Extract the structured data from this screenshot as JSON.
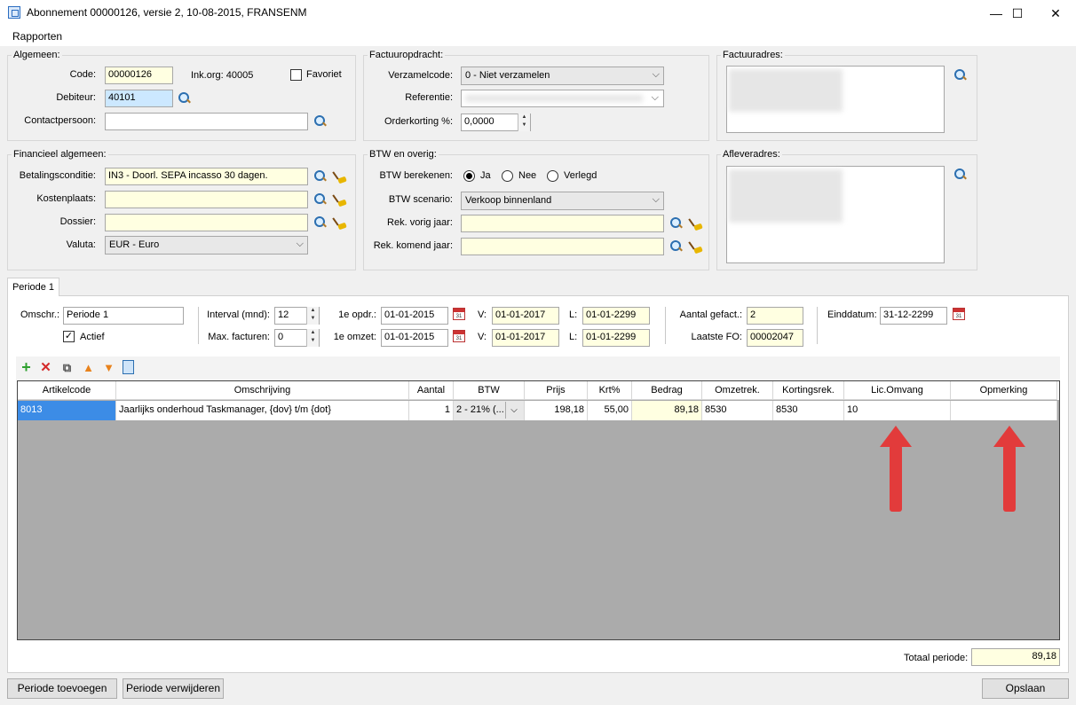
{
  "window": {
    "title": "Abonnement 00000126, versie 2, 10-08-2015, FRANSENM",
    "minimize": "—",
    "maximize": "☐",
    "close": "✕"
  },
  "menu": {
    "rapporten": "Rapporten"
  },
  "algemeen": {
    "legend": "Algemeen:",
    "code_label": "Code:",
    "code_value": "00000126",
    "inkorg": "Ink.org: 40005",
    "favoriet": "Favoriet",
    "debiteur_label": "Debiteur:",
    "debiteur_value": "40101",
    "contact_label": "Contactpersoon:",
    "contact_value": ""
  },
  "factuuropdracht": {
    "legend": "Factuuropdracht:",
    "verzamel_label": "Verzamelcode:",
    "verzamel_value": "0 - Niet verzamelen",
    "referentie_label": "Referentie:",
    "orderkorting_label": "Orderkorting %:",
    "orderkorting_value": "0,0000"
  },
  "factuuradres": {
    "legend": "Factuuradres:"
  },
  "financieel": {
    "legend": "Financieel algemeen:",
    "betaling_label": "Betalingsconditie:",
    "betaling_value": "IN3 - Doorl. SEPA incasso 30 dagen.",
    "kosten_label": "Kostenplaats:",
    "kosten_value": "",
    "dossier_label": "Dossier:",
    "dossier_value": "",
    "valuta_label": "Valuta:",
    "valuta_value": "EUR - Euro"
  },
  "btw": {
    "legend": "BTW en overig:",
    "berekenen_label": "BTW berekenen:",
    "ja": "Ja",
    "nee": "Nee",
    "verlegd": "Verlegd",
    "selected": "Ja",
    "scenario_label": "BTW scenario:",
    "scenario_value": "Verkoop binnenland",
    "vorig_label": "Rek. vorig jaar:",
    "komend_label": "Rek. komend jaar:"
  },
  "afleveradres": {
    "legend": "Afleveradres:"
  },
  "tabs": {
    "periode1": "Periode 1"
  },
  "periode": {
    "omschr_label": "Omschr.:",
    "omschr_value": "Periode 1",
    "actief": "Actief",
    "actief_checked": true,
    "interval_label": "Interval (mnd):",
    "interval_value": "12",
    "max_label": "Max. facturen:",
    "max_value": "0",
    "opdr_label": "1e opdr.:",
    "opdr_value": "01-01-2015",
    "omzet_label": "1e omzet:",
    "omzet_value": "01-01-2015",
    "v_label": "V:",
    "v1_value": "01-01-2017",
    "v2_value": "01-01-2017",
    "l_label": "L:",
    "l1_value": "01-01-2299",
    "l2_value": "01-01-2299",
    "gefact_label": "Aantal gefact.:",
    "gefact_value": "2",
    "laatste_label": "Laatste FO:",
    "laatste_value": "00002047",
    "eind_label": "Einddatum:",
    "eind_value": "31-12-2299",
    "cal_day": "31"
  },
  "grid": {
    "headers": [
      "Artikelcode",
      "Omschrijving",
      "Aantal",
      "BTW",
      "Prijs",
      "Krt%",
      "Bedrag",
      "Omzetrek.",
      "Kortingsrek.",
      "Lic.Omvang",
      "Opmerking"
    ],
    "row": {
      "artikelcode": "8013",
      "omschrijving": "Jaarlijks onderhoud Taskmanager, {dov} t/m {dot}",
      "aantal": "1",
      "btw": "2 - 21% (...",
      "prijs": "198,18",
      "krt": "55,00",
      "bedrag": "89,18",
      "omzetrek": "8530",
      "kortingsrek": "8530",
      "licomvang": "10",
      "opmerking": ""
    }
  },
  "totaal": {
    "label": "Totaal periode:",
    "value": "89,18"
  },
  "buttons": {
    "toevoegen": "Periode toevoegen",
    "verwijderen": "Periode verwijderen",
    "opslaan": "Opslaan"
  },
  "icons": {
    "add": "add-icon",
    "delete": "delete-icon",
    "copy": "copy-icon",
    "up": "move-up-icon",
    "down": "move-down-icon",
    "calc": "calculator-icon"
  },
  "colors": {
    "required_field": "#ffffe1",
    "selected_field": "#cce8ff",
    "grid_selection": "#3c8ce6",
    "annotation_arrow": "#e23b3b"
  }
}
